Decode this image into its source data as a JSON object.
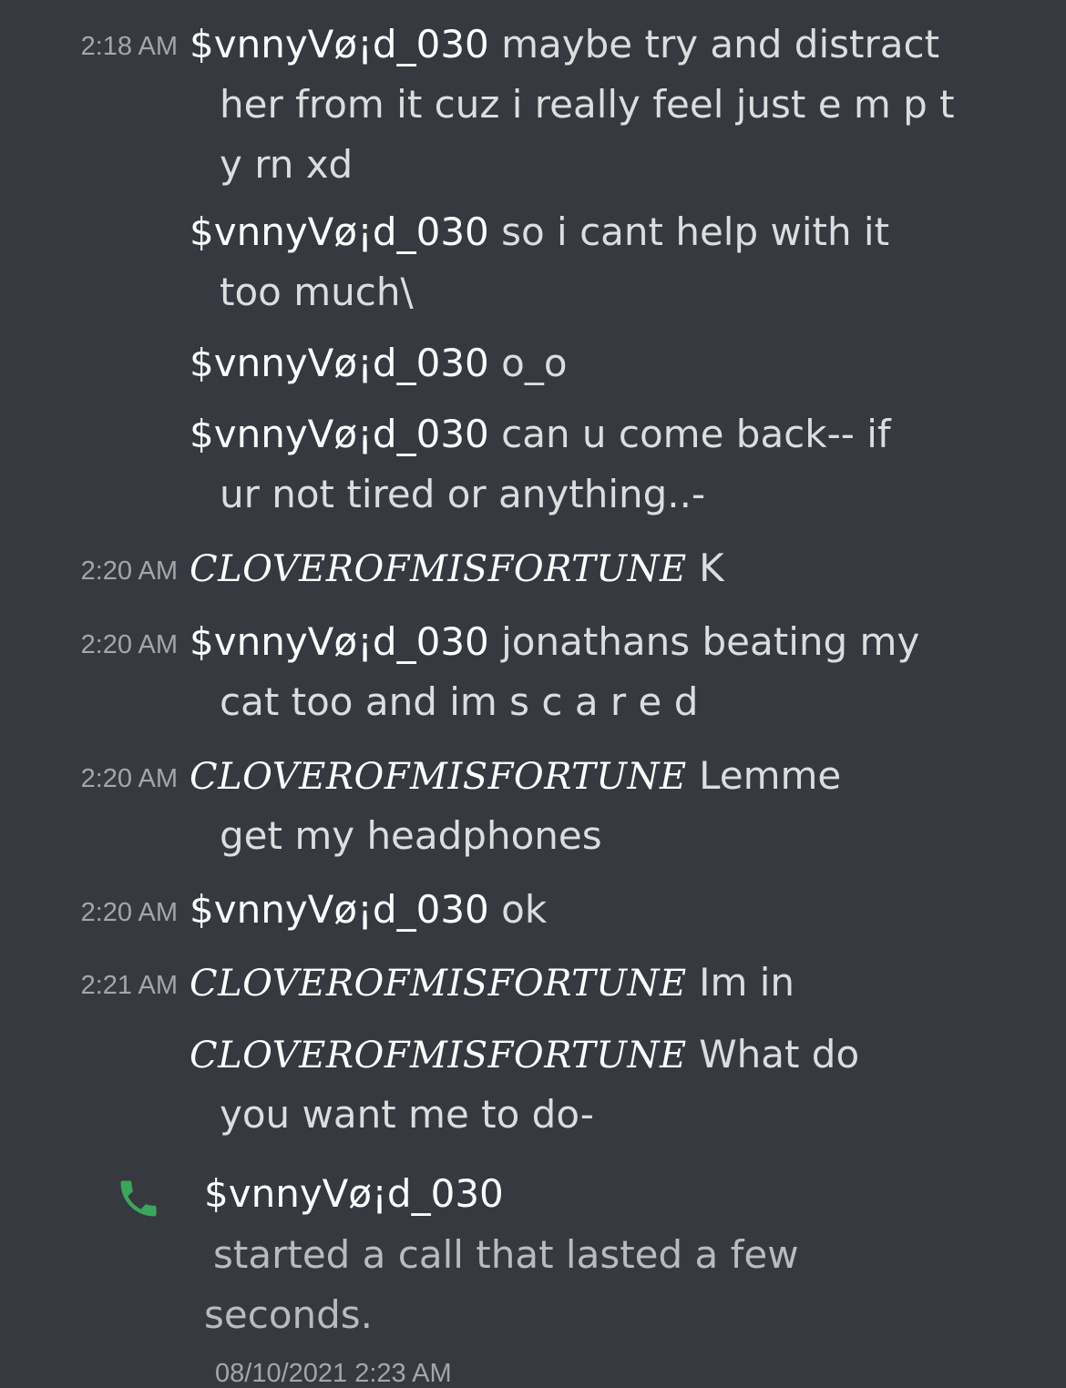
{
  "messages": [
    {
      "timestamp": "2:18 AM",
      "author": "$vnnyVø¡d_030",
      "text_first": "maybe try and distract",
      "text_cont": [
        "her from it cuz i really feel just e m p t",
        "y rn xd"
      ]
    },
    {
      "timestamp": "",
      "author": "$vnnyVø¡d_030",
      "text_first": "so i cant help with it",
      "text_cont": [
        "too much\\"
      ]
    },
    {
      "timestamp": "",
      "author": "$vnnyVø¡d_030",
      "text_first": "o_o",
      "text_cont": []
    },
    {
      "timestamp": "",
      "author": "$vnnyVø¡d_030",
      "text_first": "can u come back-- if",
      "text_cont": [
        "ur not tired or anything..-"
      ]
    },
    {
      "timestamp": "2:20 AM",
      "author": "CLOVEROFMISFORTUNE",
      "text_first": "K",
      "text_cont": []
    },
    {
      "timestamp": "2:20 AM",
      "author": "$vnnyVø¡d_030",
      "text_first": "jonathans beating my",
      "text_cont": [
        "cat too and im s c a r e  d"
      ]
    },
    {
      "timestamp": "2:20 AM",
      "author": "CLOVEROFMISFORTUNE",
      "text_first": "Lemme",
      "text_cont": [
        "get my headphones"
      ]
    },
    {
      "timestamp": "2:20 AM",
      "author": "$vnnyVø¡d_030",
      "text_first": "ok",
      "text_cont": []
    },
    {
      "timestamp": "2:21 AM",
      "author": "CLOVEROFMISFORTUNE",
      "text_first": "Im in",
      "text_cont": []
    },
    {
      "timestamp": "",
      "author": "CLOVEROFMISFORTUNE",
      "text_first": "What do",
      "text_cont": [
        "you want me to do-"
      ]
    }
  ],
  "call": {
    "icon": "phone-icon",
    "icon_color": "#3ba55c",
    "author": "$vnnyVø¡d_030",
    "text_line1": "started a call that lasted a few",
    "text_line2": "seconds.",
    "date": "08/10/2021 2:23 AM"
  },
  "colors": {
    "background": "#36393f",
    "author": "#ffffff",
    "message_text": "#dcddde",
    "timestamp": "#a3a6aa"
  }
}
